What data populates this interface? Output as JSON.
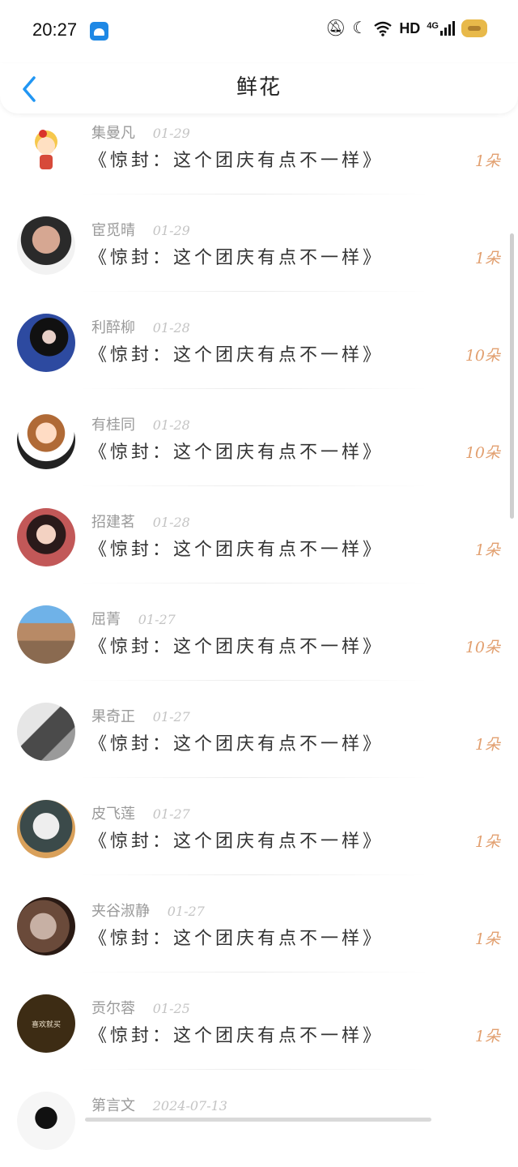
{
  "status_bar": {
    "time": "20:27",
    "network": "HD",
    "net_type": "4G"
  },
  "header": {
    "title": "鲜花"
  },
  "items": [
    {
      "name": "集曼凡",
      "date": "01-29",
      "title": "《惊封：这个团庆有点不一样》",
      "count": "1朵",
      "avatar_color": "#f6c84d"
    },
    {
      "name": "宦觅晴",
      "date": "01-29",
      "title": "《惊封：这个团庆有点不一样》",
      "count": "1朵",
      "avatar_color": "#c98f7b"
    },
    {
      "name": "利醉柳",
      "date": "01-28",
      "title": "《惊封：这个团庆有点不一样》",
      "count": "10朵",
      "avatar_color": "#1a2a52"
    },
    {
      "name": "有桂同",
      "date": "01-28",
      "title": "《惊封：这个团庆有点不一样》",
      "count": "10朵",
      "avatar_color": "#a86a3c"
    },
    {
      "name": "招建茗",
      "date": "01-28",
      "title": "《惊封：这个团庆有点不一样》",
      "count": "1朵",
      "avatar_color": "#8a3b3b"
    },
    {
      "name": "屈菁",
      "date": "01-27",
      "title": "《惊封：这个团庆有点不一样》",
      "count": "10朵",
      "avatar_color": "#9c7b5a"
    },
    {
      "name": "果奇正",
      "date": "01-27",
      "title": "《惊封：这个团庆有点不一样》",
      "count": "1朵",
      "avatar_color": "#8c8c8c"
    },
    {
      "name": "皮飞莲",
      "date": "01-27",
      "title": "《惊封：这个团庆有点不一样》",
      "count": "1朵",
      "avatar_color": "#3b4a4a"
    },
    {
      "name": "夹谷淑静",
      "date": "01-27",
      "title": "《惊封：这个团庆有点不一样》",
      "count": "1朵",
      "avatar_color": "#6a4a3a"
    },
    {
      "name": "贡尔蓉",
      "date": "01-25",
      "title": "《惊封：这个团庆有点不一样》",
      "count": "1朵",
      "avatar_color": "#3d2c14",
      "avatar_text": "喜欢就买"
    },
    {
      "name": "第言文",
      "date": "2024-07-13",
      "title": "",
      "count": "",
      "avatar_color": "#e9e9e9"
    }
  ],
  "colors": {
    "accent": "#2196f3",
    "count": "#e2a070"
  }
}
